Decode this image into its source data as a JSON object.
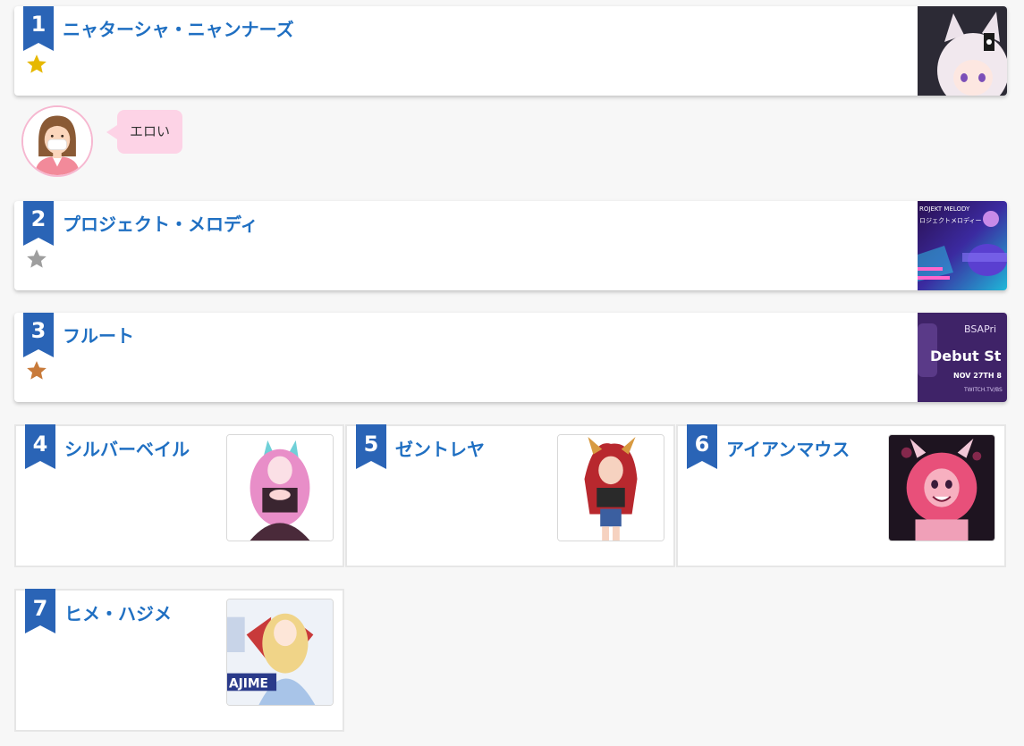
{
  "ranking_top": [
    {
      "rank": "1",
      "name": "ニャターシャ・ニャンナーズ",
      "medal": "gold",
      "medal_color": "#e6b800",
      "thumb_icon": "white-haired-catgirl-illustration"
    },
    {
      "rank": "2",
      "name": "プロジェクト・メロディ",
      "medal": "silver",
      "medal_color": "#9e9e9e",
      "thumb_icon": "projekt-melody-banner",
      "thumb_text_top": "ROJEKT MELODY",
      "thumb_text_sub": "ロジェクトメロディー"
    },
    {
      "rank": "3",
      "name": "フルート",
      "medal": "bronze",
      "medal_color": "#c87a3a",
      "thumb_icon": "debut-stream-banner",
      "thumb_text_logo": "BSAPri",
      "thumb_text_main": "Debut St",
      "thumb_text_date": "NOV 27TH 8",
      "thumb_text_url": "TWITCH.TV/BS"
    }
  ],
  "comment": {
    "avatar_icon": "masked-woman-avatar",
    "text": "エロい",
    "bubble_color": "#fdd3e6"
  },
  "ranking_grid": [
    {
      "rank": "4",
      "name": "シルバーベイル",
      "thumb_icon": "pink-haired-wolfgirl-illustration"
    },
    {
      "rank": "5",
      "name": "ゼントレヤ",
      "thumb_icon": "red-haired-dragon-girl-illustration"
    },
    {
      "rank": "6",
      "name": "アイアンマウス",
      "thumb_icon": "pink-haired-demon-girl-illustration"
    },
    {
      "rank": "7",
      "name": "ヒメ・ハジメ",
      "thumb_icon": "blonde-winged-girl-illustration",
      "thumb_text": "AJIME"
    }
  ],
  "colors": {
    "ribbon": "#2a64b6",
    "title": "#1f6fc2",
    "background": "#f7f7f7"
  }
}
